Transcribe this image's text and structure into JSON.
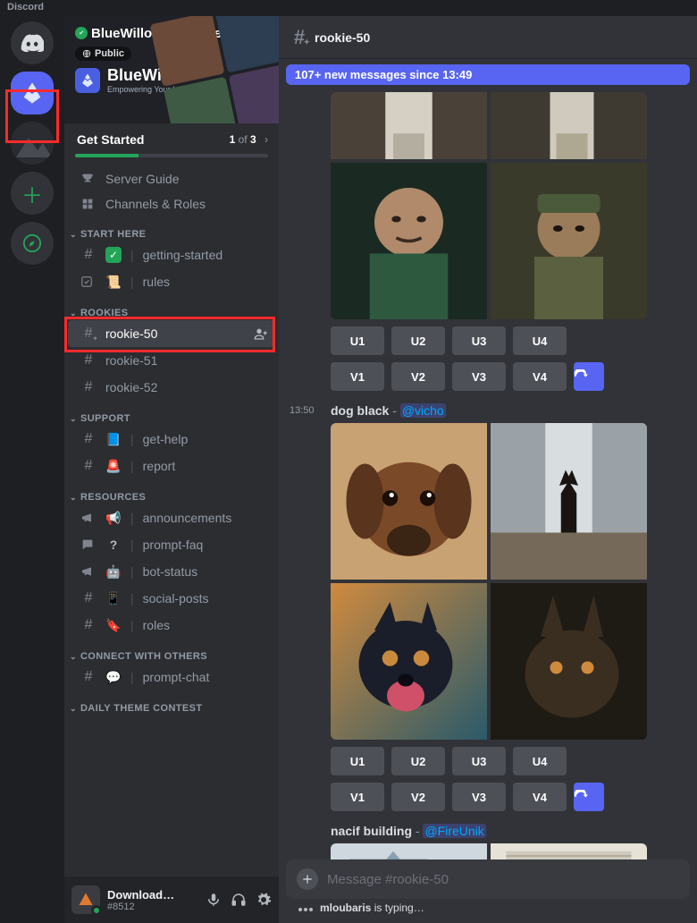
{
  "app": {
    "title": "Discord"
  },
  "server": {
    "name": "BlueWillow AI to Crea…",
    "public_chip": "Public",
    "brand_name": "BlueWillow",
    "brand_sub": "Empowering Your Imagination"
  },
  "get_started": {
    "title": "Get Started",
    "current": "1",
    "sep": "of",
    "total": "3",
    "progress_pct": 33
  },
  "welcome": {
    "server_guide": "Server Guide",
    "channels_roles": "Channels & Roles"
  },
  "sections": {
    "start_here": "START HERE",
    "rookies": "ROOKIES",
    "support": "SUPPORT",
    "resources": "RESOURCES",
    "connect": "CONNECT WITH OTHERS",
    "daily": "DAILY THEME CONTEST"
  },
  "channels": {
    "getting_started": "getting-started",
    "rules": "rules",
    "rookie_50": "rookie-50",
    "rookie_51": "rookie-51",
    "rookie_52": "rookie-52",
    "get_help": "get-help",
    "report": "report",
    "announcements": "announcements",
    "prompt_faq": "prompt-faq",
    "bot_status": "bot-status",
    "social_posts": "social-posts",
    "roles": "roles",
    "prompt_chat": "prompt-chat"
  },
  "header": {
    "channel_name": "rookie-50"
  },
  "new_messages": "107+ new messages since 13:49",
  "messages": [
    {
      "time": "",
      "prompt": "",
      "author": "",
      "u_labels": [
        "U1",
        "U2",
        "U3",
        "U4"
      ],
      "v_labels": [
        "V1",
        "V2",
        "V3",
        "V4"
      ]
    },
    {
      "time": "13:50",
      "prompt": "dog black",
      "author": "@vicho",
      "u_labels": [
        "U1",
        "U2",
        "U3",
        "U4"
      ],
      "v_labels": [
        "V1",
        "V2",
        "V3",
        "V4"
      ]
    },
    {
      "time": "",
      "prompt": "nacif building",
      "author": "@FireUnik"
    }
  ],
  "composer": {
    "placeholder": "Message #rookie-50"
  },
  "typing": {
    "user": "mloubaris",
    "suffix": "is typing…"
  },
  "user_panel": {
    "name": "Download…",
    "tag": "#8512"
  },
  "icons": {
    "discord": "discord-logo-icon",
    "bluewillow": "bluewillow-logo-icon",
    "image": "image-icon",
    "plus": "plus-icon",
    "compass": "compass-icon",
    "trophy": "trophy-icon",
    "grid": "grid-icon",
    "hash": "hash-icon",
    "megaphone": "megaphone-icon",
    "chat": "chat-bubble-icon",
    "mic": "microphone-icon",
    "headphones": "headphones-icon",
    "gear": "gear-icon",
    "refresh": "refresh-icon",
    "chev_right": "chevron-right-icon",
    "chev_down": "chevron-down-icon",
    "add_user": "add-user-icon",
    "check_square": "check-square-icon"
  }
}
